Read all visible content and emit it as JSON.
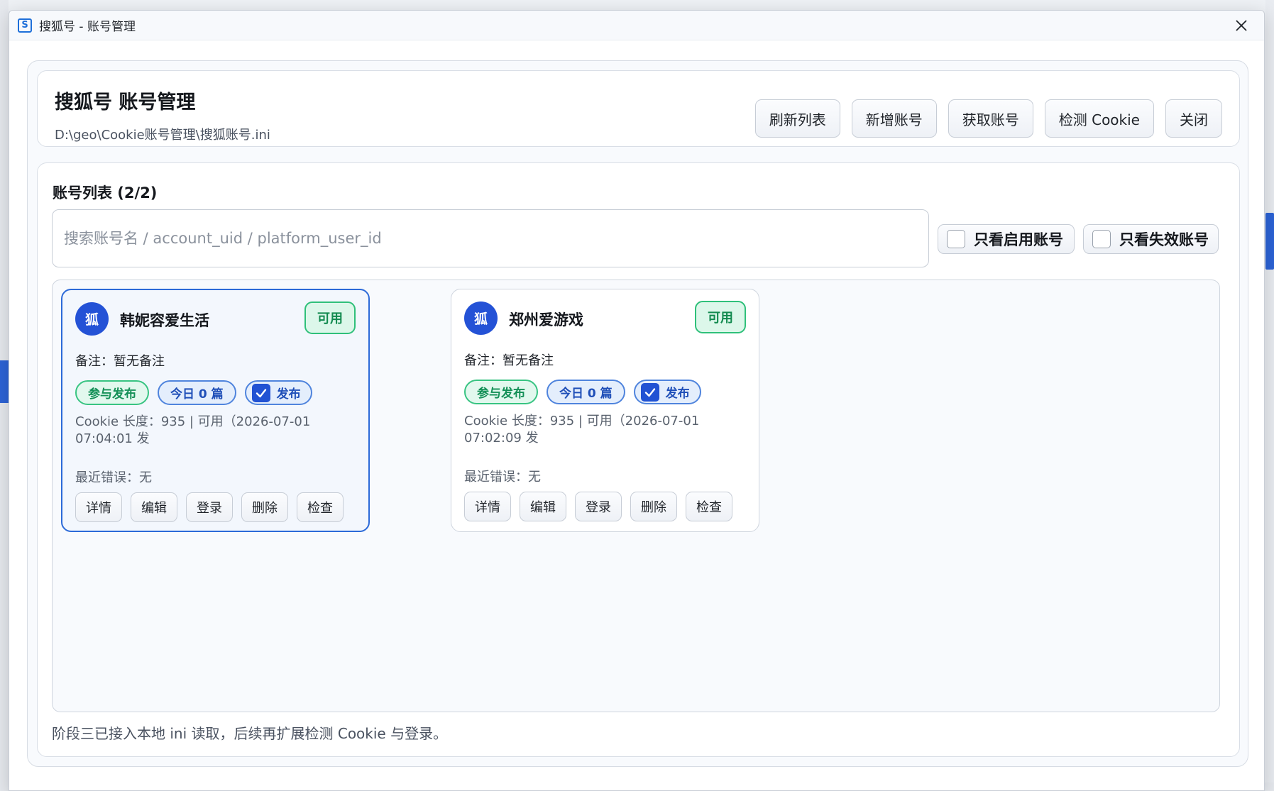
{
  "window": {
    "title": "搜狐号 - 账号管理",
    "icon_glyph": "S"
  },
  "header": {
    "title": "搜狐号 账号管理",
    "path": "D:\\geo\\Cookie账号管理\\搜狐账号.ini",
    "buttons": {
      "refresh": "刷新列表",
      "add": "新增账号",
      "fetch": "获取账号",
      "check_cookie": "检测 Cookie",
      "close": "关闭"
    }
  },
  "list": {
    "title": "账号列表 (2/2)",
    "search_placeholder": "搜索账号名 / account_uid / platform_user_id",
    "filters": {
      "only_enabled": "只看启用账号",
      "only_invalid": "只看失效账号"
    },
    "accounts": [
      {
        "avatar": "狐",
        "name": "韩妮容爱生活",
        "status": "可用",
        "remark": "备注：暂无备注",
        "tag_participate": "参与发布",
        "tag_today": "今日 0 篇",
        "tag_publish": "发布",
        "cookie_info": "Cookie 长度：935 | 可用（2026-07-01 07:04:01 发",
        "last_error": "最近错误：无",
        "actions": [
          "详情",
          "编辑",
          "登录",
          "删除",
          "检查"
        ]
      },
      {
        "avatar": "狐",
        "name": "郑州爱游戏",
        "status": "可用",
        "remark": "备注：暂无备注",
        "tag_participate": "参与发布",
        "tag_today": "今日 0 篇",
        "tag_publish": "发布",
        "cookie_info": "Cookie 长度：935 | 可用（2026-07-01 07:02:09 发",
        "last_error": "最近错误：无",
        "actions": [
          "详情",
          "编辑",
          "登录",
          "删除",
          "检查"
        ]
      }
    ]
  },
  "footer_note": "阶段三已接入本地 ini 读取，后续再扩展检测 Cookie 与登录。",
  "colors": {
    "accent": "#2c6ad8",
    "avatar_bg": "#2452d6",
    "status_green": "#2fc07a",
    "tag_blue": "#4f84dd"
  }
}
